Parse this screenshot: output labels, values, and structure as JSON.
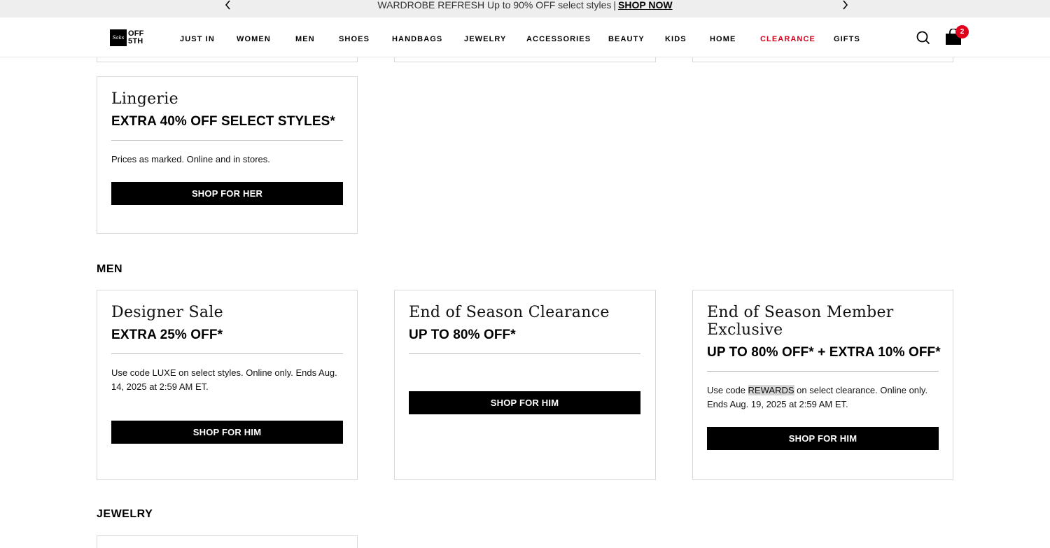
{
  "promo": {
    "text": "WARDROBE REFRESH Up to 90% OFF select styles",
    "separator": "|",
    "link": "SHOP NOW"
  },
  "header": {
    "logo_script": "Saks",
    "logo_line1": "OFF",
    "logo_line2": "5TH",
    "nav": [
      "JUST IN",
      "WOMEN",
      "MEN",
      "SHOES",
      "HANDBAGS",
      "JEWELRY",
      "ACCESSORIES",
      "BEAUTY",
      "KIDS",
      "HOME",
      "CLEARANCE",
      "GIFTS"
    ],
    "cart_count": "2",
    "clearance_color": "#d0021b",
    "badge_color": "#e0001b"
  },
  "lingerie": {
    "title": "Lingerie",
    "offer": "EXTRA 40% OFF SELECT STYLES*",
    "desc": "Prices as marked. Online and in stores.",
    "button": "SHOP FOR HER"
  },
  "men": {
    "section_title": "MEN",
    "cards": [
      {
        "title": "Designer Sale",
        "offer": "EXTRA 25% OFF*",
        "desc": "Use code LUXE on select styles. Online only. Ends Aug. 14, 2025 at 2:59 AM ET.",
        "button": "SHOP FOR HIM"
      },
      {
        "title": "End of Season Clearance",
        "offer": "UP TO 80% OFF*",
        "desc": "",
        "button": "SHOP FOR HIM"
      },
      {
        "title": "End of Season Member Exclusive",
        "offer": "UP TO 80% OFF* + EXTRA 10% OFF*",
        "desc_before": "Use code",
        "desc_code": "REWARDS",
        "desc_after": "on select clearance. Online only. Ends Aug. 19, 2025 at 2:59 AM ET.",
        "button": "SHOP FOR HIM"
      }
    ]
  },
  "jewelry": {
    "section_title": "JEWELRY"
  }
}
